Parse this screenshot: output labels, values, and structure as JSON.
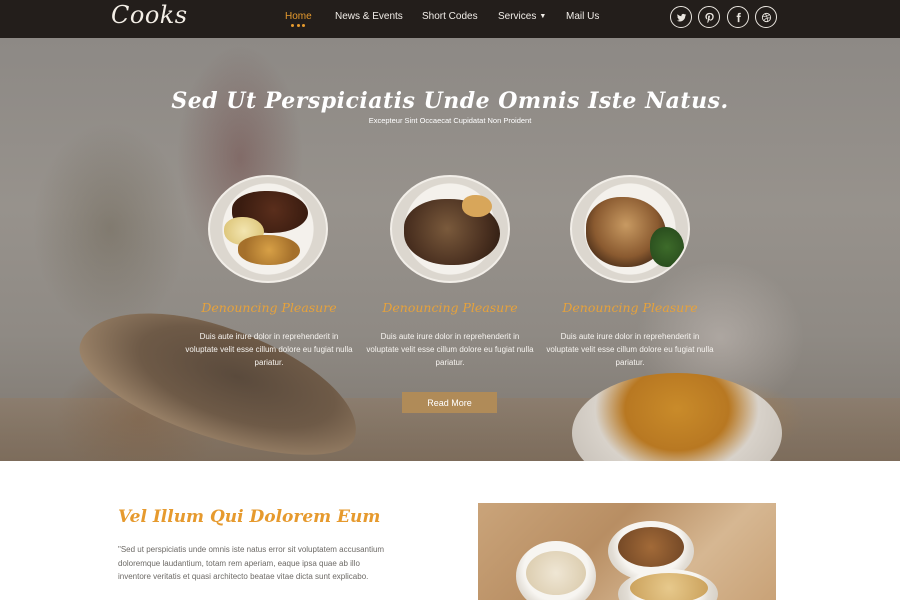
{
  "brand": {
    "logo": "Cooks"
  },
  "nav": [
    {
      "label": "Home",
      "active": true
    },
    {
      "label": "News & Events",
      "active": false
    },
    {
      "label": "Short Codes",
      "active": false
    },
    {
      "label": "Services",
      "active": false,
      "has_dropdown": true
    },
    {
      "label": "Mail Us",
      "active": false
    }
  ],
  "social": [
    {
      "icon": "twitter-icon"
    },
    {
      "icon": "pinterest-icon"
    },
    {
      "icon": "facebook-icon"
    },
    {
      "icon": "dribbble-icon"
    }
  ],
  "hero": {
    "title": "Sed Ut Perspiciatis Unde Omnis Iste Natus.",
    "subtitle": "Excepteur Sint Occaecat Cupidatat Non Proident",
    "cta_label": "Read More"
  },
  "features": [
    {
      "title": "Denouncing Pleasure",
      "text": "Duis aute irure dolor in reprehenderit in voluptate velit esse cillum dolore eu fugiat nulla pariatur."
    },
    {
      "title": "Denouncing Pleasure",
      "text": "Duis aute irure dolor in reprehenderit in voluptate velit esse cillum dolore eu fugiat nulla pariatur."
    },
    {
      "title": "Denouncing Pleasure",
      "text": "Duis aute irure dolor in reprehenderit in voluptate velit esse cillum dolore eu fugiat nulla pariatur."
    }
  ],
  "about": {
    "title": "Vel Illum Qui Dolorem Eum",
    "text": "\"Sed ut perspiciatis unde omnis iste natus error sit voluptatem accusantium doloremque laudantium, totam rem aperiam, eaque ipsa quae ab illo inventore veritatis et quasi architecto beatae vitae dicta sunt explicabo."
  },
  "colors": {
    "header_bg": "#231e1b",
    "accent": "#e69a2e",
    "button_bg": "#b08b58",
    "body_text": "#6d6a66"
  }
}
